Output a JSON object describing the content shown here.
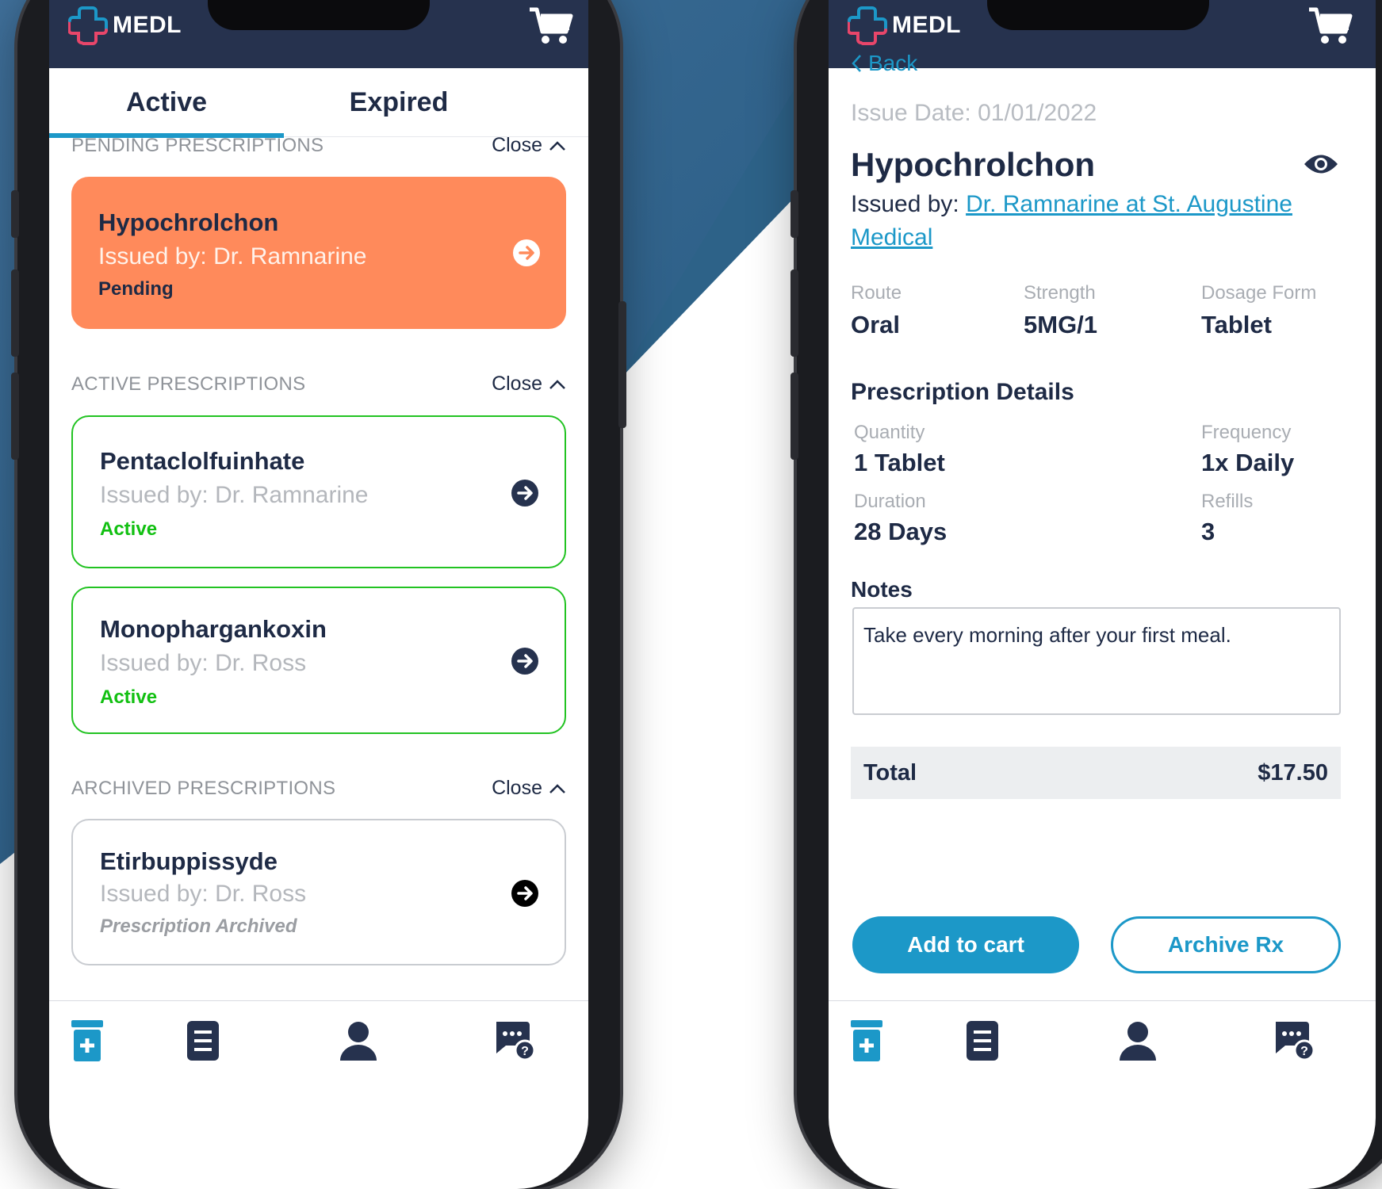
{
  "brand": {
    "name": "MEDL",
    "navy": "#26324e",
    "accent": "#1c98c8",
    "pending_color": "#ff8a5b",
    "active_color": "#22c322"
  },
  "list_screen": {
    "tabs": [
      {
        "label": "Active",
        "selected": true
      },
      {
        "label": "Expired",
        "selected": false
      }
    ],
    "sections": [
      {
        "title": "PENDING PRESCRIPTIONS",
        "toggle": "Close",
        "items": [
          {
            "name": "Hypochrolchon",
            "issued": "Issued by: Dr. Ramnarine",
            "status": "Pending"
          }
        ]
      },
      {
        "title": "ACTIVE PRESCRIPTIONS",
        "toggle": "Close",
        "items": [
          {
            "name": "Pentaclolfuinhate",
            "issued": "Issued by: Dr. Ramnarine",
            "status": "Active"
          },
          {
            "name": "Monophargankoxin",
            "issued": "Issued by: Dr. Ross",
            "status": "Active"
          }
        ]
      },
      {
        "title": "ARCHIVED PRESCRIPTIONS",
        "toggle": "Close",
        "items": [
          {
            "name": "Etirbuppissyde",
            "issued": "Issued by: Dr. Ross",
            "status": "Prescription Archived"
          }
        ]
      }
    ]
  },
  "detail_screen": {
    "back_label": "Back",
    "issue_date": "Issue Date: 01/01/2022",
    "drug_name": "Hypochrolchon",
    "issued_prefix": "Issued by: ",
    "issued_link": "Dr. Ramnarine at St. Augustine Medical",
    "route_label": "Route",
    "route_value": "Oral",
    "strength_label": "Strength",
    "strength_value": "5MG/1",
    "dosage_label": "Dosage Form",
    "dosage_value": "Tablet",
    "details_heading": "Prescription Details",
    "quantity_label": "Quantity",
    "quantity_value": "1 Tablet",
    "frequency_label": "Frequency",
    "frequency_value": "1x Daily",
    "duration_label": "Duration",
    "duration_value": "28 Days",
    "refills_label": "Refills",
    "refills_value": "3",
    "notes_heading": "Notes",
    "notes_text": "Take every morning after your first meal.",
    "total_label": "Total",
    "total_value": "$17.50",
    "add_to_cart_label": "Add to cart",
    "archive_label": "Archive Rx"
  },
  "bottom_nav_icons": [
    "prescription-bottle-icon",
    "orders-list-icon",
    "profile-icon",
    "help-chat-icon"
  ]
}
